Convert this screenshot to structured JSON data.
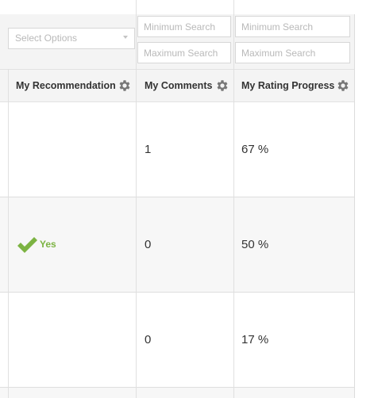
{
  "filters": {
    "select_placeholder": "Select Options",
    "comments_min_placeholder": "Minimum Search",
    "comments_max_placeholder": "Maximum Search",
    "progress_min_placeholder": "Minimum Search",
    "progress_max_placeholder": "Maximum Search"
  },
  "columns": [
    {
      "label": "My Recommendation",
      "icon": "gear-icon"
    },
    {
      "label": "My Comments",
      "icon": "gear-icon"
    },
    {
      "label": "My Rating Progress",
      "icon": "gear-icon"
    }
  ],
  "rows": [
    {
      "recommendation": "",
      "comments": "1",
      "progress": "67 %"
    },
    {
      "recommendation": "Yes",
      "comments": "0",
      "progress": "50 %"
    },
    {
      "recommendation": "",
      "comments": "0",
      "progress": "17 %"
    }
  ],
  "colors": {
    "accent_green": "#7cb342",
    "header_bg": "#f4f4f4",
    "alt_row_bg": "#f7f7f7"
  }
}
